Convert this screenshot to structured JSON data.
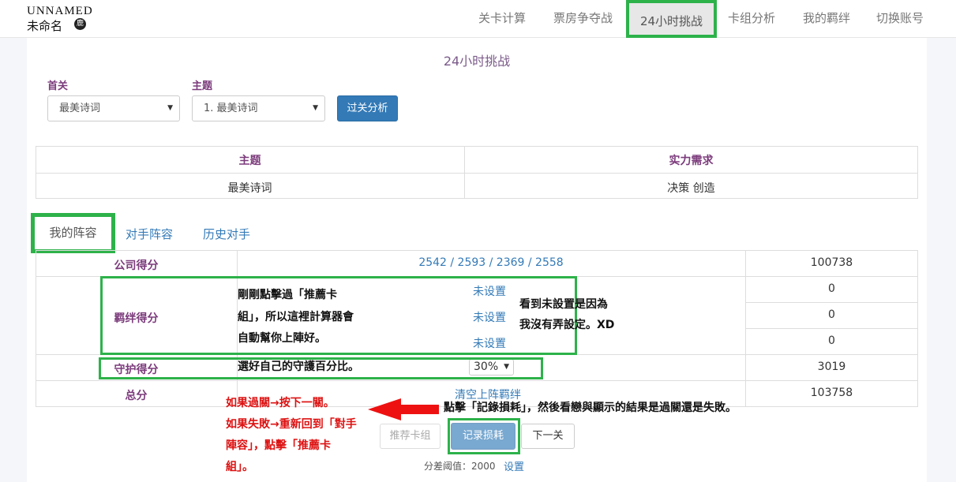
{
  "logo": {
    "line1": "UNNAMED",
    "line2": "未命名",
    "mark": "鹿"
  },
  "nav": {
    "items": [
      "关卡计算",
      "票房争夺战",
      "24小时挑战",
      "卡组分析",
      "我的羁绊",
      "切换账号"
    ],
    "active_index": 2
  },
  "page": {
    "title": "24小时挑战"
  },
  "filters": {
    "level_label": "首关",
    "level_value": "最美诗词",
    "theme_label": "主题",
    "theme_value": "1. 最美诗词",
    "submit_label": "过关分析"
  },
  "info_table": {
    "headers": [
      "主题",
      "实力需求"
    ],
    "row": [
      "最美诗词",
      "决策 创造"
    ]
  },
  "tabs": [
    "我的阵容",
    "对手阵容",
    "历史对手"
  ],
  "scores": {
    "company_label": "公司得分",
    "company_values": "2542 / 2593 / 2369 / 2558",
    "company_total": "100738",
    "bond_label": "羁绊得分",
    "bond_links": [
      "未设置",
      "未设置",
      "未设置"
    ],
    "bond_values": [
      "0",
      "0",
      "0"
    ],
    "guard_label": "守护得分",
    "guard_select": "30%",
    "guard_value": "3019",
    "total_label": "总分",
    "clear_link": "清空上阵羁绊",
    "total_value": "103758"
  },
  "actions": {
    "recommend": "推荐卡组",
    "record": "记录损耗",
    "next": "下一关"
  },
  "threshold": {
    "label": "分差阈值：2000",
    "link": "设置"
  },
  "annotations": {
    "bond_note": [
      "剛剛點擊過「推薦卡",
      "組」，所以這裡計算器會",
      "自動幫你上陣好。"
    ],
    "unset_note": [
      "看到未設置是因為",
      "我沒有弄設定。XD"
    ],
    "guard_note": "選好自己的守護百分比。",
    "record_note": "點擊「記錄損耗」，然後看戀與顯示的結果是過關還是失敗。",
    "red_note": [
      "如果過關→按下一關。",
      "如果失敗→重新回到「對手",
      "陣容」，點擊「推薦卡",
      "組」。"
    ]
  },
  "colors": {
    "accent": "#337ab7",
    "highlight_box": "#2db24a",
    "label_purple": "#7b3b7b",
    "arrow_red": "#e11"
  }
}
